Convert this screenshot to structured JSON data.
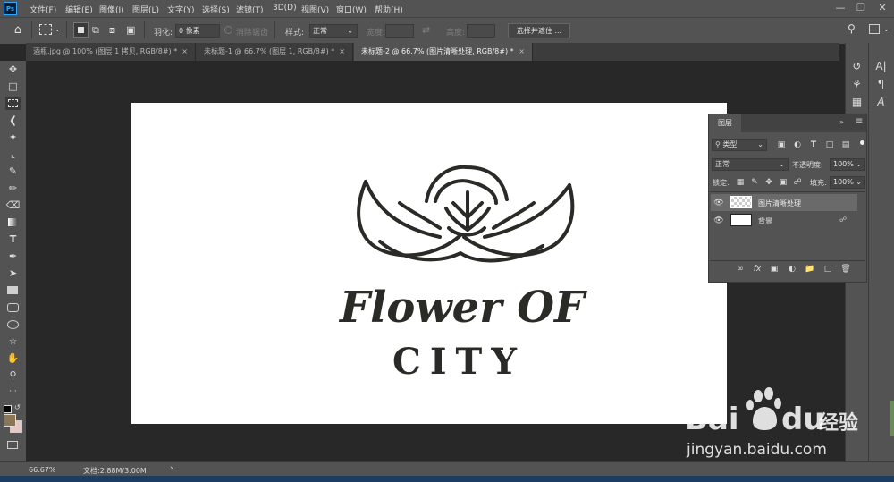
{
  "app": {
    "logo": "Ps"
  },
  "menu": [
    "文件(F)",
    "编辑(E)",
    "图像(I)",
    "图层(L)",
    "文字(Y)",
    "选择(S)",
    "滤镜(T)",
    "3D(D)",
    "视图(V)",
    "窗口(W)",
    "帮助(H)"
  ],
  "options": {
    "feather_label": "羽化:",
    "feather_value": "0 像素",
    "antialias_label": "消除锯齿",
    "style_label": "样式:",
    "style_value": "正常",
    "width_label": "宽度:",
    "height_label": "高度:",
    "select_mask_button": "选择并遮住 ..."
  },
  "tabs": [
    {
      "label": "酒瓶.jpg @ 100% (图层 1 拷贝, RGB/8#) *",
      "active": false
    },
    {
      "label": "未标题-1 @ 66.7% (图层 1, RGB/8#) *",
      "active": false
    },
    {
      "label": "未标题-2 @ 66.7% (图片清晰处理, RGB/8#) *",
      "active": true
    }
  ],
  "close_glyph": "×",
  "canvas": {
    "artwork_text_line1": "Flower OF",
    "artwork_text_line2": "CITY",
    "background": "#ffffff"
  },
  "layers_panel": {
    "tab_label": "图层",
    "filter_value": "类型",
    "blend_mode": "正常",
    "opacity_label": "不透明度:",
    "opacity_value": "100%",
    "lock_label": "锁定:",
    "fill_label": "填充:",
    "fill_value": "100%",
    "layers": [
      {
        "name": "图片清晰处理",
        "selected": true,
        "thumb": "transparent"
      },
      {
        "name": "背景",
        "selected": false,
        "thumb": "white",
        "locked": true
      }
    ],
    "footer_fx": "fx"
  },
  "status": {
    "zoom": "66.67%",
    "doc_info": "文档:2.88M/3.00M"
  },
  "watermark": {
    "brand_latin": "Bai",
    "brand_latin2": "du",
    "brand_cn": "经验",
    "url": "jingyan.baidu.com"
  },
  "colors": {
    "accent": "#31a8ff",
    "panel": "#535353",
    "workspace": "#282828",
    "foreground_swatch": "#8b7656",
    "background_swatch": "#e8c7c7"
  }
}
